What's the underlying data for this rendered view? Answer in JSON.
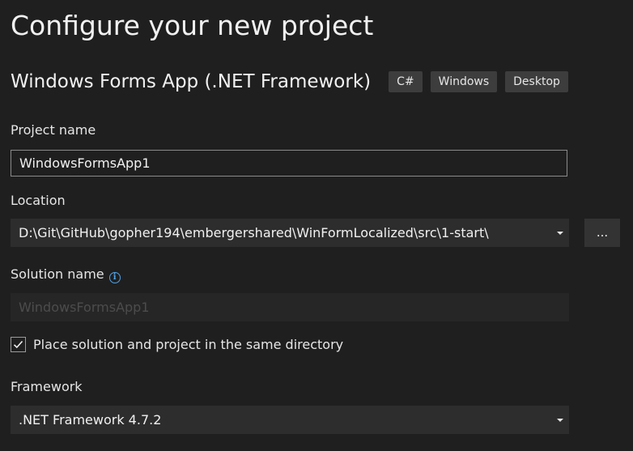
{
  "page": {
    "title": "Configure your new project"
  },
  "template": {
    "name": "Windows Forms App (.NET Framework)",
    "tags": [
      "C#",
      "Windows",
      "Desktop"
    ]
  },
  "project_name": {
    "label": "Project name",
    "value": "WindowsFormsApp1"
  },
  "location": {
    "label": "Location",
    "value": "D:\\Git\\GitHub\\gopher194\\embergershared\\WinFormLocalized\\src\\1-start\\",
    "browse_label": "..."
  },
  "solution_name": {
    "label": "Solution name",
    "placeholder": "WindowsFormsApp1",
    "info_icon": "info-icon"
  },
  "same_directory": {
    "label": "Place solution and project in the same directory",
    "checked": true
  },
  "framework": {
    "label": "Framework",
    "value": ".NET Framework 4.7.2"
  },
  "colors": {
    "background": "#1f1f1f",
    "info_accent": "#4fa3e8",
    "tag_background": "#3d3d3d"
  }
}
